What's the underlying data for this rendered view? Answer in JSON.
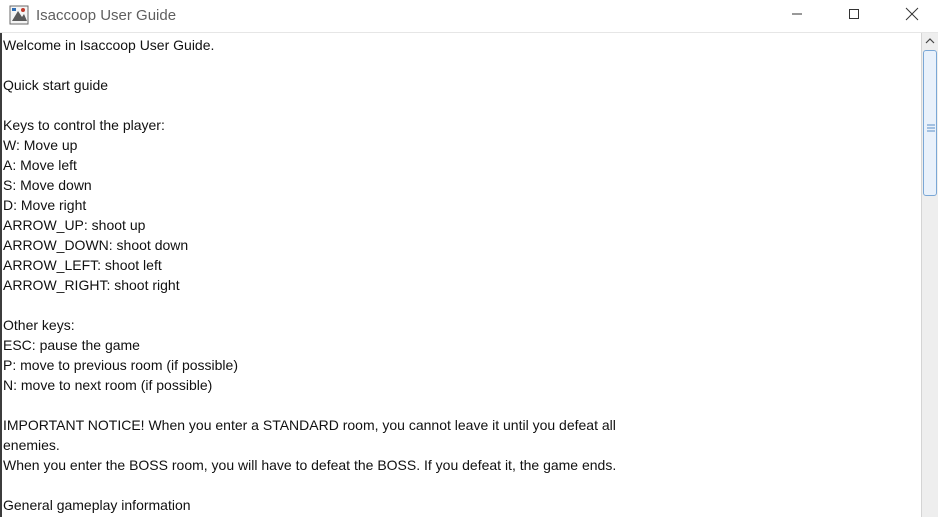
{
  "window": {
    "title": "Isaccoop User Guide",
    "icon": "app-icon",
    "controls": [
      "minimize-icon",
      "maximize-icon",
      "close-icon"
    ]
  },
  "guide": {
    "lines": [
      "Welcome in Isaccoop User Guide.",
      "",
      "Quick start guide",
      "",
      "Keys to control the player:",
      "W: Move up",
      "A: Move left",
      "S: Move down",
      "D: Move right",
      "ARROW_UP: shoot up",
      "ARROW_DOWN: shoot down",
      "ARROW_LEFT: shoot left",
      "ARROW_RIGHT: shoot right",
      "",
      "Other keys:",
      "ESC: pause the game",
      "P: move to previous room (if possible)",
      "N: move to next room (if possible)",
      "",
      "IMPORTANT NOTICE! When you enter a STANDARD room, you cannot leave it until you defeat all",
      "enemies.",
      "When you enter the BOSS room, you will have to defeat the BOSS. If you defeat it, the game ends.",
      "",
      "General gameplay information"
    ]
  },
  "colors": {
    "scroll_thumb_border": "#7aa7d6",
    "scroll_thumb_fill": "#e9f1fb",
    "title_text": "#5f5f5f"
  }
}
